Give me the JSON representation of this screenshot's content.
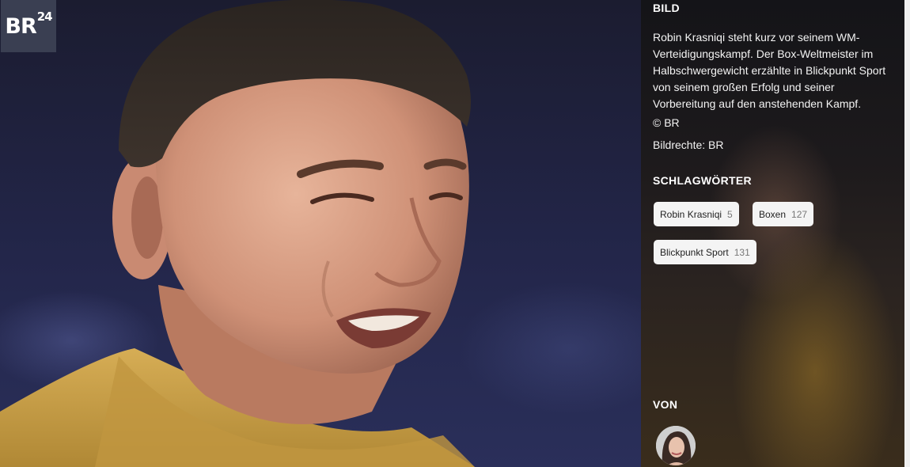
{
  "logo": {
    "text": "BR",
    "number": "24"
  },
  "sidebar": {
    "bild_heading": "BILD",
    "caption": "Robin Krasniqi steht kurz vor seinem WM-Verteidigungskampf. Der Box-Weltmeister im Halbschwergewicht erzählte in Blickpunkt Sport von seinem großen Erfolg und seiner Vorbereitung auf den anstehenden Kampf.",
    "copyright": "© BR",
    "rights": "Bildrechte: BR",
    "tags_heading": "SCHLAGWÖRTER",
    "tags": [
      {
        "label": "Robin Krasniqi",
        "count": "5"
      },
      {
        "label": "Boxen",
        "count": "127"
      },
      {
        "label": "Blickpunkt Sport",
        "count": "131"
      }
    ],
    "von_heading": "VON"
  },
  "colors": {
    "shirt": "#c9a24a",
    "background": "#1f2240",
    "logo_bg": "#3a3f52"
  }
}
